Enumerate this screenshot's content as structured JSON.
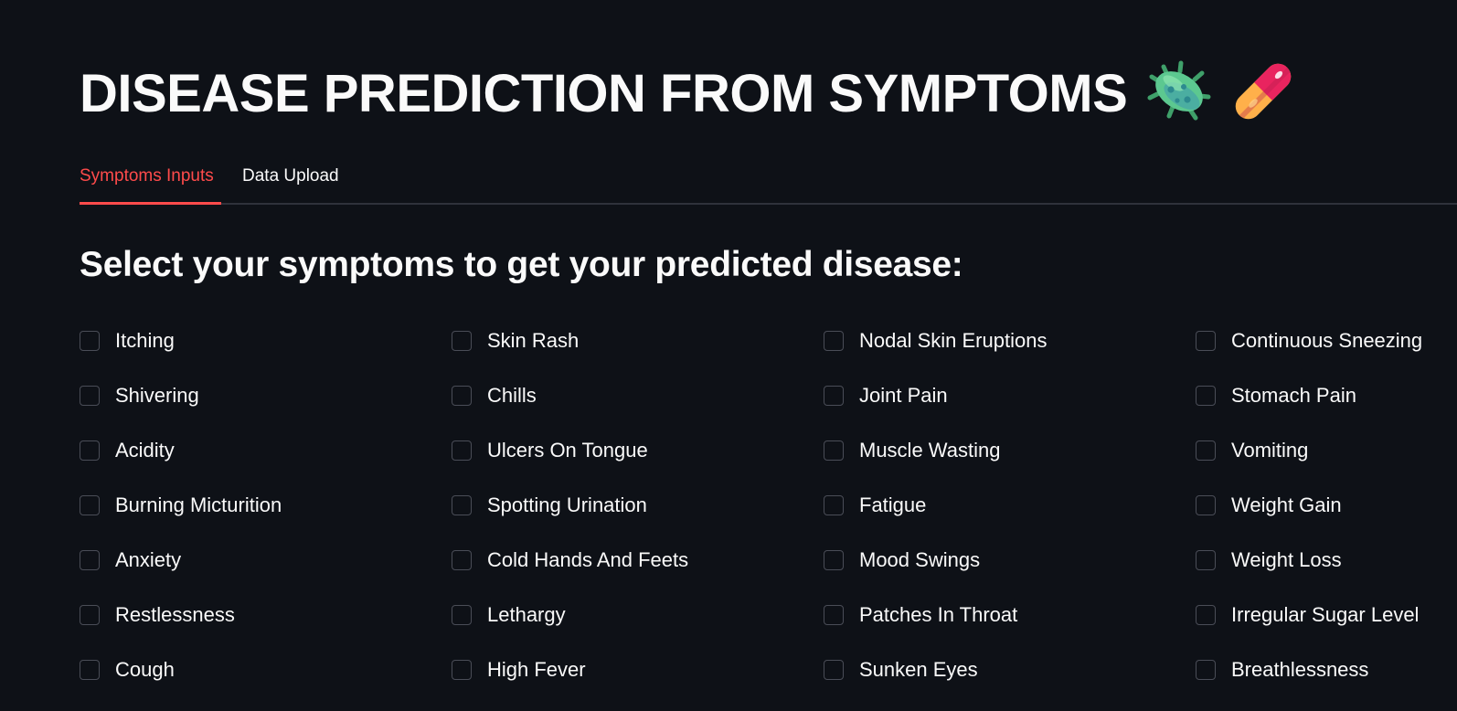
{
  "header": {
    "title": "DISEASE PREDICTION FROM SYMPTOMS",
    "icons": [
      "microbe-icon",
      "pill-icon"
    ]
  },
  "tabs": [
    {
      "label": "Symptoms Inputs",
      "active": true
    },
    {
      "label": "Data Upload",
      "active": false
    }
  ],
  "main": {
    "subheading": "Select your symptoms to get your predicted disease:",
    "symptom_rows": [
      [
        "Itching",
        "Skin Rash",
        "Nodal Skin Eruptions",
        "Continuous Sneezing"
      ],
      [
        "Shivering",
        "Chills",
        "Joint Pain",
        "Stomach Pain"
      ],
      [
        "Acidity",
        "Ulcers On Tongue",
        "Muscle Wasting",
        "Vomiting"
      ],
      [
        "Burning Micturition",
        "Spotting Urination",
        "Fatigue",
        "Weight Gain"
      ],
      [
        "Anxiety",
        "Cold Hands And Feets",
        "Mood Swings",
        "Weight Loss"
      ],
      [
        "Restlessness",
        "Lethargy",
        "Patches In Throat",
        "Irregular Sugar Level"
      ],
      [
        "Cough",
        "High Fever",
        "Sunken Eyes",
        "Breathlessness"
      ]
    ]
  },
  "colors": {
    "background": "#0e1117",
    "text": "#fafafa",
    "accent": "#ff4b4b",
    "checkbox_border": "#4a4d57"
  }
}
